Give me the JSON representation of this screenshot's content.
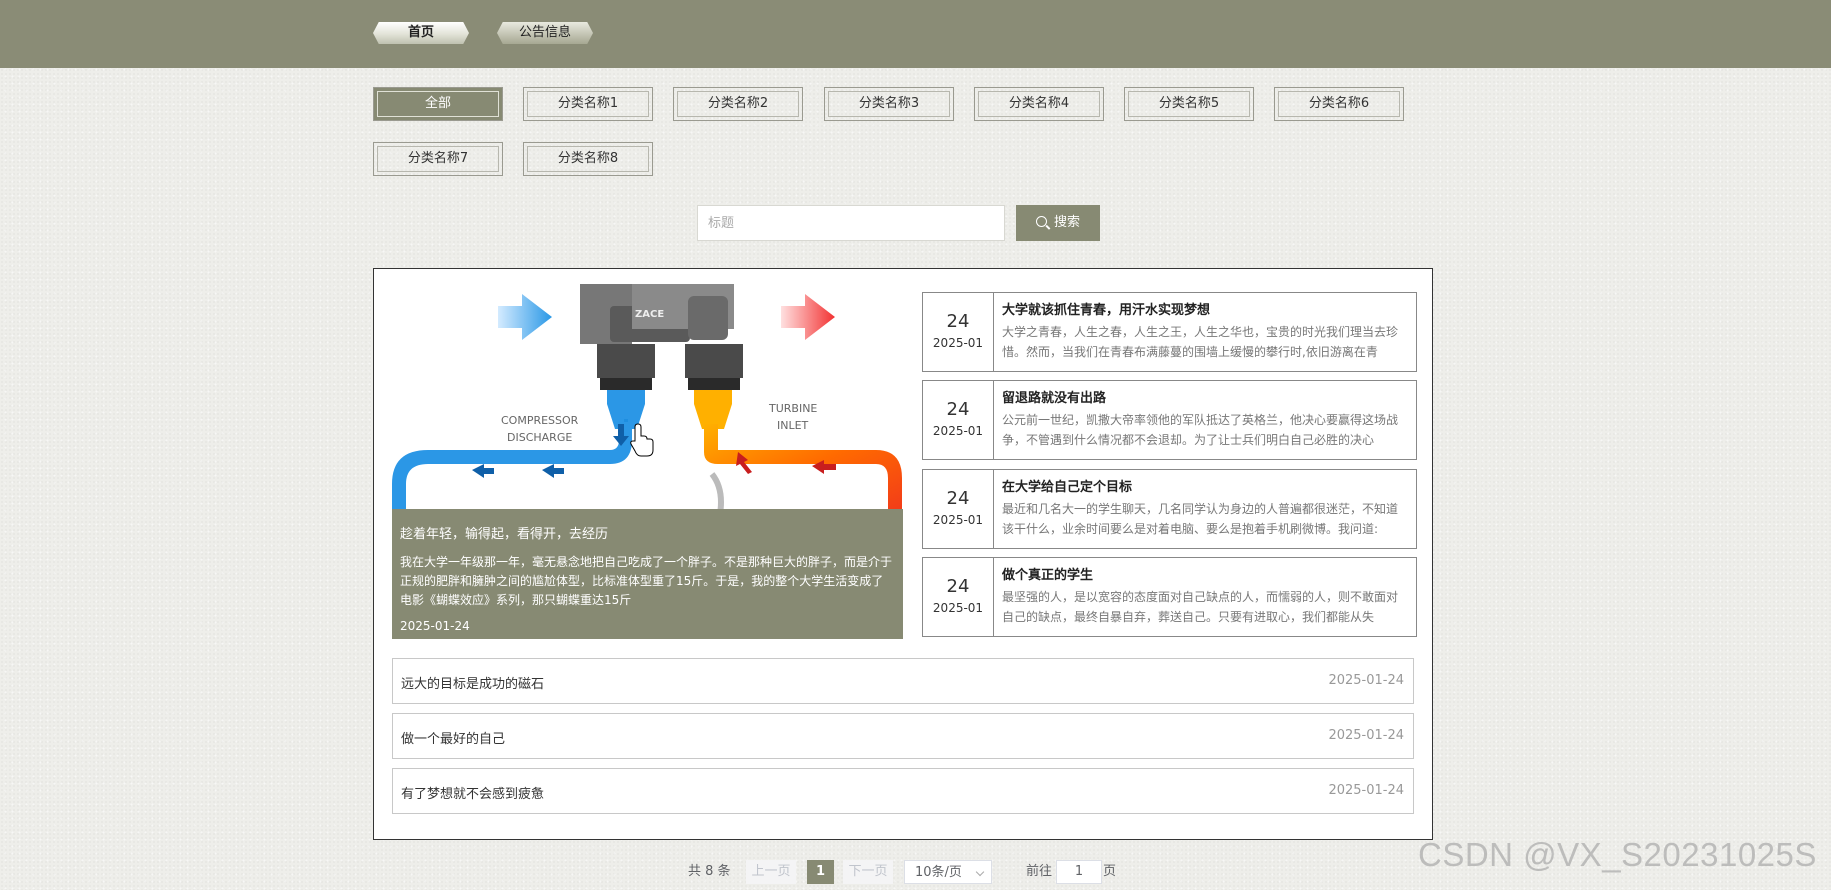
{
  "nav": {
    "home": "首页",
    "notice": "公告信息"
  },
  "categories": [
    "全部",
    "分类名称1",
    "分类名称2",
    "分类名称3",
    "分类名称4",
    "分类名称5",
    "分类名称6",
    "分类名称7",
    "分类名称8"
  ],
  "search": {
    "placeholder": "标题",
    "button": "搜索"
  },
  "feature": {
    "image_labels": {
      "left": [
        "COMPRESSOR",
        "DISCHARGE"
      ],
      "right": [
        "TURBINE",
        "INLET"
      ],
      "logo": "ZACE"
    },
    "title": "趁着年轻，输得起，看得开，去经历",
    "desc": "我在大学一年级那一年，毫无悬念地把自己吃成了一个胖子。不是那种巨大的胖子，而是介于正规的肥胖和臃肿之间的尴尬体型，比标准体型重了15斤。于是，我的整个大学生活变成了电影《蝴蝶效应》系列，那只蝴蝶重达15斤",
    "date": "2025-01-24"
  },
  "news": [
    {
      "day": "24",
      "ym": "2025-01",
      "title": "大学就该抓住青春，用汗水实现梦想",
      "desc": "大学之青春，人生之春，人生之王，人生之华也，宝贵的时光我们理当去珍惜。然而，当我们在青春布满藤蔓的围墙上缓慢的攀行时,依旧游离在青"
    },
    {
      "day": "24",
      "ym": "2025-01",
      "title": "留退路就没有出路",
      "desc": "公元前一世纪，凯撒大帝率领他的军队抵达了英格兰，他决心要赢得这场战争，不管遇到什么情况都不会退却。为了让士兵们明白自己必胜的决心"
    },
    {
      "day": "24",
      "ym": "2025-01",
      "title": "在大学给自己定个目标",
      "desc": "最近和几名大一的学生聊天，几名同学认为身边的人普遍都很迷茫，不知道该干什么，业余时间要么是对着电脑、要么是抱着手机刷微博。我问道:"
    },
    {
      "day": "24",
      "ym": "2025-01",
      "title": "做个真正的学生",
      "desc": "最坚强的人，是以宽容的态度面对自己缺点的人，而懦弱的人，则不敢面对自己的缺点，最终自暴自弃，葬送自己。只要有进取心，我们都能从失"
    }
  ],
  "rows": [
    {
      "title": "远大的目标是成功的磁石",
      "date": "2025-01-24"
    },
    {
      "title": "做一个最好的自己",
      "date": "2025-01-24"
    },
    {
      "title": "有了梦想就不会感到疲惫",
      "date": "2025-01-24"
    }
  ],
  "pager": {
    "total": "共 8 条",
    "prev": "上一页",
    "current": "1",
    "next": "下一页",
    "size": "10条/页",
    "goto": "前往",
    "goto_value": "1",
    "unit": "页"
  },
  "watermark": "CSDN @VX_S20231025S"
}
